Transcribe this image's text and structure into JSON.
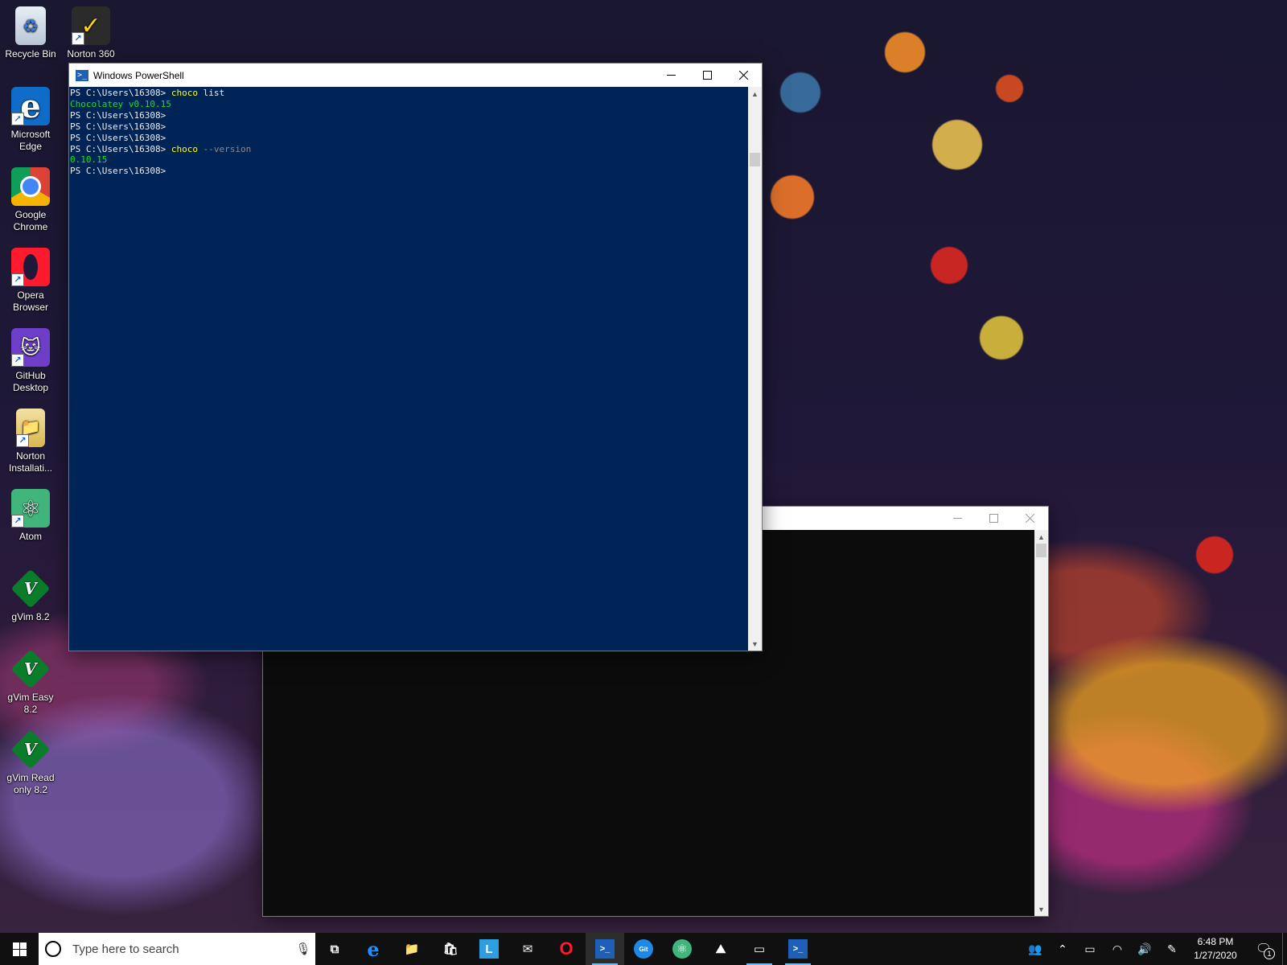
{
  "desktop": {
    "icons": [
      {
        "label": "Recycle Bin",
        "glyph": "♻"
      },
      {
        "label": "Norton 360",
        "glyph": "✓"
      },
      {
        "label": "Microsoft Edge",
        "glyph": "e"
      },
      {
        "label": "Google Chrome",
        "glyph": ""
      },
      {
        "label": "Opera Browser",
        "glyph": ""
      },
      {
        "label": "GitHub Desktop",
        "glyph": "🐱"
      },
      {
        "label": "Norton Installati...",
        "glyph": "📁"
      },
      {
        "label": "Atom",
        "glyph": "⚛"
      },
      {
        "label": "gVim 8.2",
        "glyph": "V"
      },
      {
        "label": "gVim Easy 8.2",
        "glyph": "V"
      },
      {
        "label": "gVim Read only 8.2",
        "glyph": "V"
      }
    ]
  },
  "powershell_window": {
    "title": "Windows PowerShell",
    "lines": [
      {
        "prompt": "PS C:\\Users\\16308> ",
        "cmd": "choco",
        "arg": " list",
        "arg_style": "plain"
      },
      {
        "output": "Chocolatey v0.10.15",
        "style": "green"
      },
      {
        "prompt": "PS C:\\Users\\16308>"
      },
      {
        "prompt": "PS C:\\Users\\16308>"
      },
      {
        "prompt": "PS C:\\Users\\16308>"
      },
      {
        "prompt": "PS C:\\Users\\16308> ",
        "cmd": "choco",
        "arg": " --version",
        "arg_style": "gray"
      },
      {
        "output": "0.10.15",
        "style": "green"
      },
      {
        "prompt": "PS C:\\Users\\16308>"
      }
    ]
  },
  "cmd_window": {
    "title": ""
  },
  "taskbar": {
    "search_placeholder": "Type here to search",
    "apps": [
      {
        "name": "task-view",
        "glyph": "⧉"
      },
      {
        "name": "edge",
        "glyph": "e"
      },
      {
        "name": "file-explorer",
        "glyph": "📁"
      },
      {
        "name": "store",
        "glyph": "🛍"
      },
      {
        "name": "lili",
        "glyph": "L"
      },
      {
        "name": "mail",
        "glyph": "✉"
      },
      {
        "name": "opera",
        "glyph": "O"
      },
      {
        "name": "powershell",
        "glyph": ">_"
      },
      {
        "name": "git-bash",
        "glyph": "Git"
      },
      {
        "name": "atom",
        "glyph": "⚛"
      },
      {
        "name": "photos",
        "glyph": "⛰"
      },
      {
        "name": "terminal",
        "glyph": "▭"
      },
      {
        "name": "powershell-2",
        "glyph": ">_"
      }
    ],
    "clock_time": "6:48 PM",
    "clock_date": "1/27/2020",
    "notification_count": "1"
  }
}
